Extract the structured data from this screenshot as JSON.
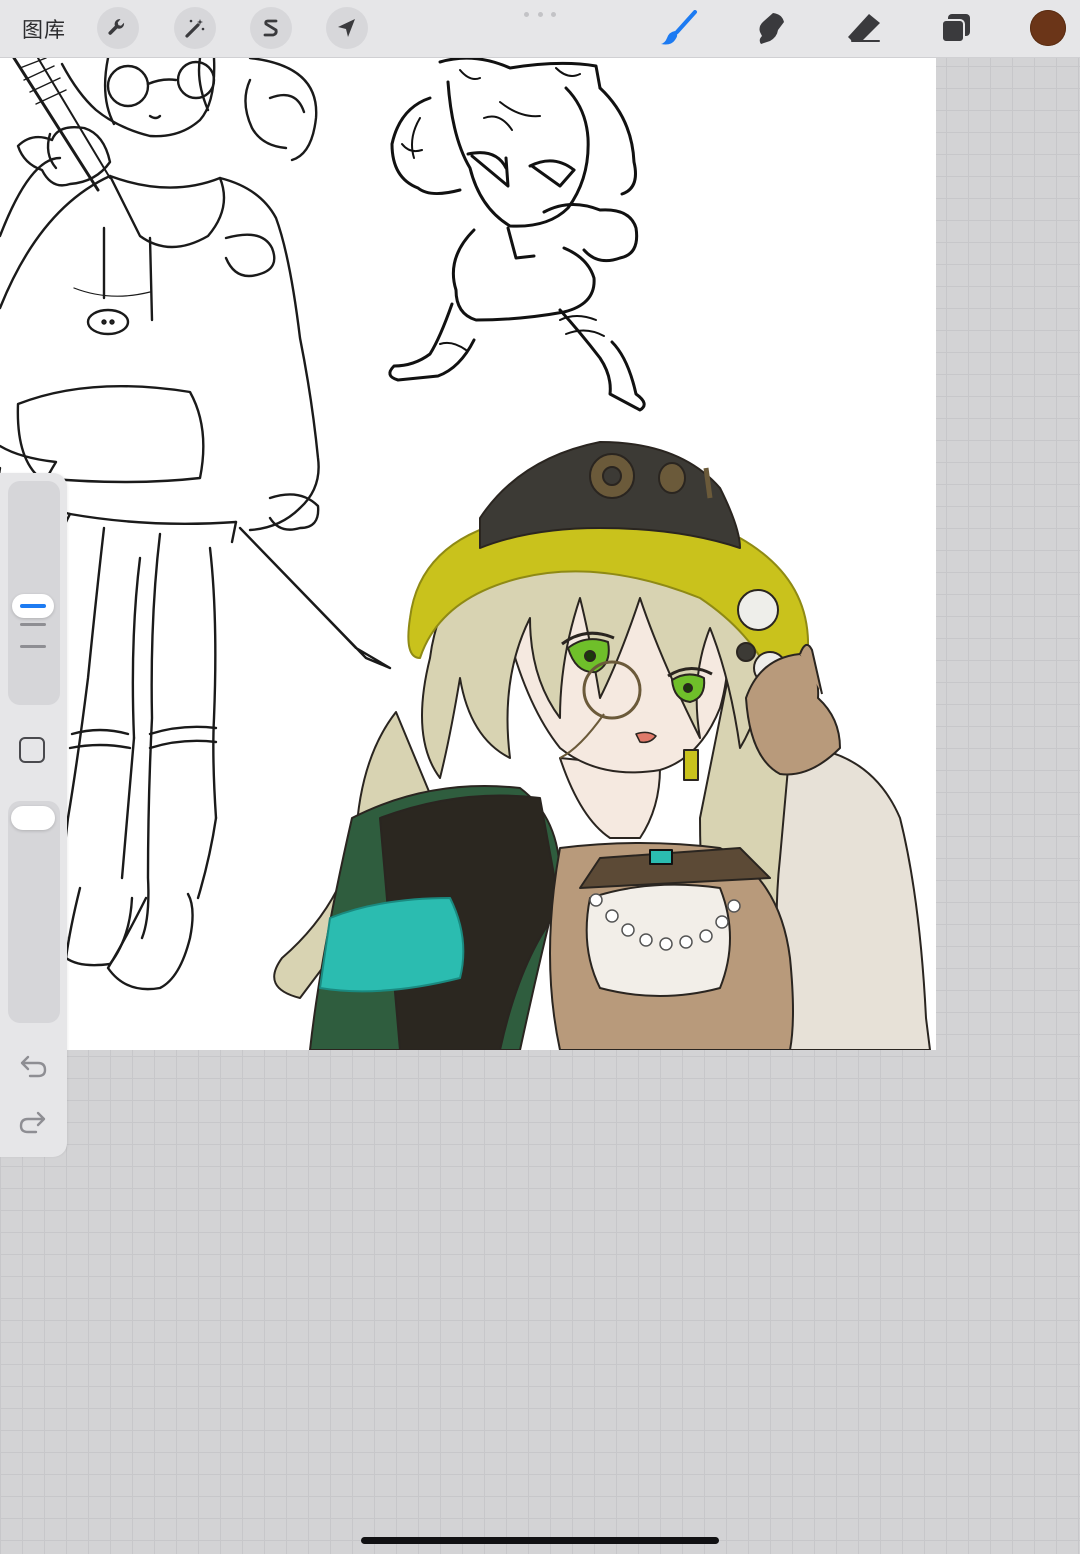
{
  "topbar": {
    "gallery_label": "图库",
    "left_tools": [
      {
        "name": "actions",
        "icon": "wrench-icon"
      },
      {
        "name": "adjustments",
        "icon": "magic-wand-icon"
      },
      {
        "name": "selection",
        "icon": "selection-s-icon"
      },
      {
        "name": "transform",
        "icon": "arrow-cursor-icon"
      }
    ],
    "right_tools": [
      {
        "name": "brush",
        "icon": "brush-icon",
        "active": true
      },
      {
        "name": "smudge",
        "icon": "smudge-icon",
        "active": false
      },
      {
        "name": "eraser",
        "icon": "eraser-icon",
        "active": false
      },
      {
        "name": "layers",
        "icon": "layers-icon",
        "active": false
      }
    ],
    "current_color": "#6b3518",
    "active_color": "#1d7bf2",
    "inactive_icon_color": "#3a3a3d"
  },
  "sidebar": {
    "icons": [
      "brush-size-slider",
      "modify-square-icon",
      "opacity-slider",
      "undo-icon",
      "redo-icon"
    ]
  },
  "canvas": {
    "background": "#ffffff",
    "palette": {
      "hat": "#c9c21c",
      "hat_crown": "#3c3a35",
      "hair": "#d8d3b2",
      "eyes": "#6fbf2a",
      "jacket": "#2b2720",
      "cuff": "#2bbcb0",
      "cloak": "#2f5d3e",
      "sleeve": "#e7e1d7",
      "skin": "#f5e9e0",
      "bodice": "#b89a7b"
    }
  }
}
